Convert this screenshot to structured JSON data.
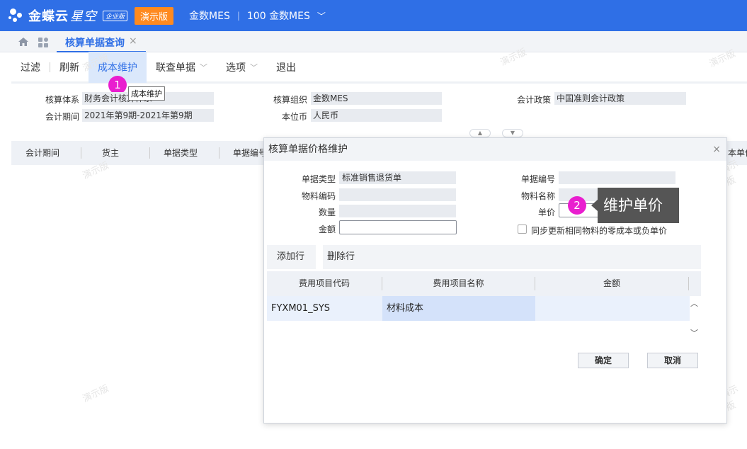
{
  "topbar": {
    "logo_text": "金蝶云",
    "logo_text2": "星空",
    "edition_badge": "企业版",
    "demo_badge": "演示版",
    "org_name": "金数MES",
    "separator": "|",
    "org_code": "100 金数MES",
    "chevron": "﹀"
  },
  "tabbar": {
    "active_tab": "核算单据查询",
    "close": "×"
  },
  "toolbar": {
    "filter": "过滤",
    "refresh": "刷新",
    "cost_maint": "成本维护",
    "linked_query": "联查单据",
    "options": "选项",
    "exit": "退出",
    "chevron": "﹀"
  },
  "markers": {
    "m1": "1",
    "m2": "2"
  },
  "tooltip": "成本维护",
  "header_form": {
    "acct_system_label": "核算体系",
    "acct_system_value": "财务会计核算体系",
    "acct_org_label": "核算组织",
    "acct_org_value": "金数MES",
    "acct_policy_label": "会计政策",
    "acct_policy_value": "中国准则会计政策",
    "period_label": "会计期间",
    "period_value": "2021年第9期-2021年第9期",
    "currency_label": "本位币",
    "currency_value": "人民币"
  },
  "collapse": {
    "up": "▲",
    "down": "▼"
  },
  "grid_columns": [
    "会计期间",
    "货主",
    "单据类型",
    "单据编号",
    "本单价"
  ],
  "watermark": "演示版",
  "dialog": {
    "title": "核算单据价格维护",
    "close": "×",
    "bill_type_label": "单据类型",
    "bill_type_value": "标准销售退货单",
    "bill_no_label": "单据编号",
    "material_code_label": "物料编码",
    "material_name_label": "物料名称",
    "qty_label": "数量",
    "price_label": "单价",
    "amount_label": "金额",
    "sync_label": "同步更新相同物料的零成本或负单价",
    "add_row": "添加行",
    "delete_row": "删除行",
    "columns": [
      "费用项目代码",
      "费用项目名称",
      "金额"
    ],
    "rows": [
      {
        "code": "FYXM01_SYS",
        "name": "材料成本",
        "amount": ""
      }
    ],
    "ok": "确定",
    "cancel": "取消",
    "scroll_up": "︿",
    "scroll_down": "﹀"
  },
  "callout": "维护单价",
  "colors": {
    "brand": "#2f6fe6",
    "demo": "#ff8a1f",
    "marker": "#e91ecf",
    "callout": "#555555"
  }
}
